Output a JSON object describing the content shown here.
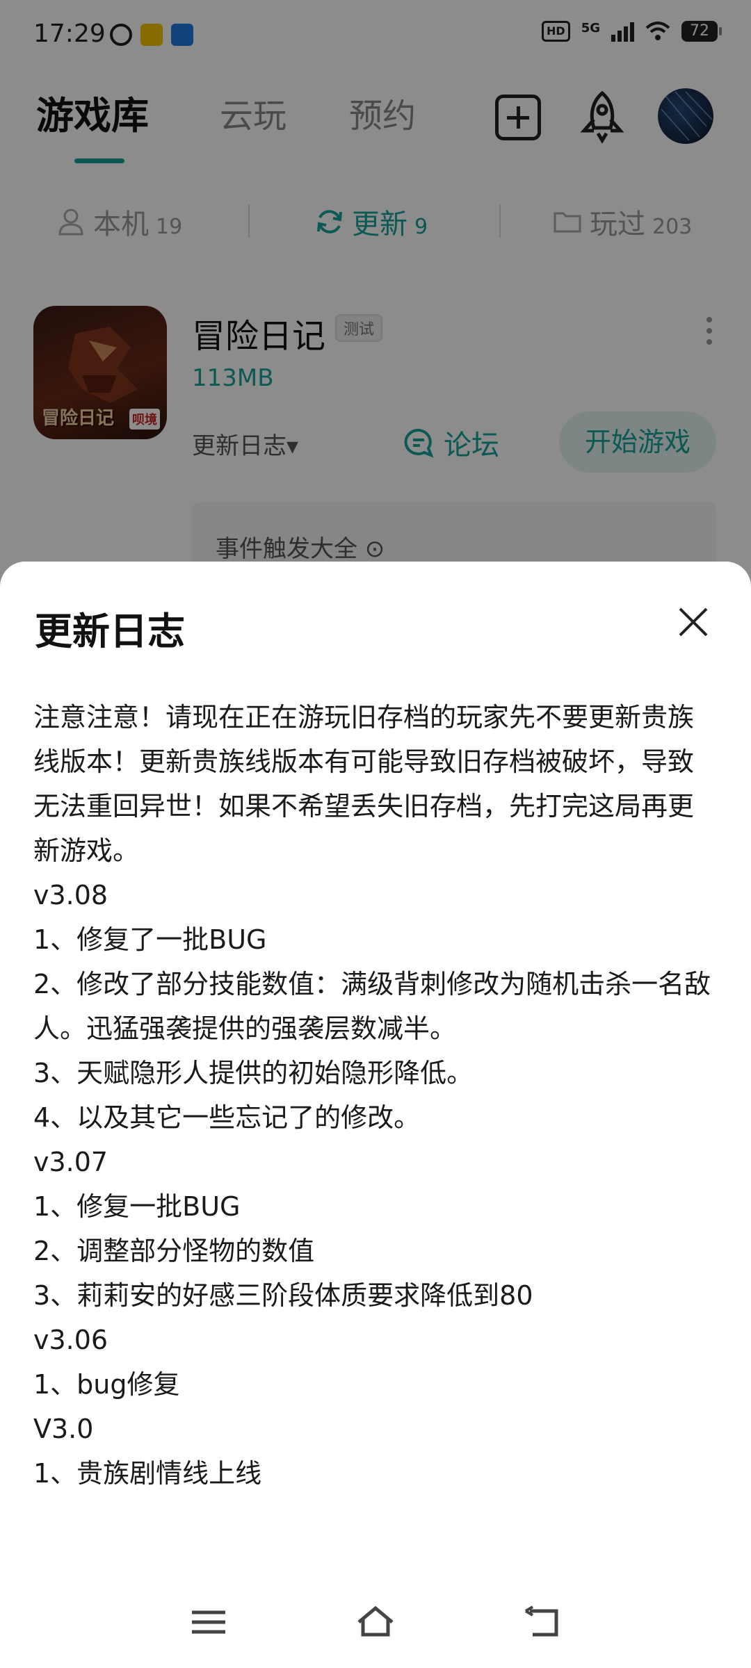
{
  "status_bar": {
    "time": "17:29",
    "hd": "HD",
    "network": "5G",
    "battery": "72"
  },
  "header": {
    "tabs": [
      {
        "label": "游戏库",
        "active": true
      },
      {
        "label": "云玩",
        "active": false
      },
      {
        "label": "预约",
        "active": false
      }
    ],
    "icons": [
      "add-icon",
      "rocket-icon",
      "avatar"
    ]
  },
  "sub_tabs": [
    {
      "label": "本机",
      "count": "19",
      "icon": "user-icon",
      "active": false
    },
    {
      "label": "更新",
      "count": "9",
      "icon": "refresh-icon",
      "active": true
    },
    {
      "label": "玩过",
      "count": "203",
      "icon": "folder-icon",
      "active": false
    }
  ],
  "game": {
    "icon_caption": "冒险日记",
    "icon_brand": "呗境",
    "title": "冒险日记",
    "badge": "测试",
    "size": "113MB",
    "changelog_link": "更新日志▾",
    "forum_label": "论坛",
    "start_label": "开始游戏",
    "event_card": "事件触发大全 ⊙"
  },
  "sheet": {
    "title": "更新日志",
    "lines": [
      "注意注意！请现在正在游玩旧存档的玩家先不要更新贵族线版本！更新贵族线版本有可能导致旧存档被破坏，导致无法重回异世！如果不希望丢失旧存档，先打完这局再更新游戏。",
      "v3.08",
      "1、修复了一批BUG",
      "2、修改了部分技能数值：满级背刺修改为随机击杀一名敌人。迅猛强袭提供的强袭层数减半。",
      "3、天赋隐形人提供的初始隐形降低。",
      "4、以及其它一些忘记了的修改。",
      "v3.07",
      "1、修复一批BUG",
      "2、调整部分怪物的数值",
      "3、莉莉安的好感三阶段体质要求降低到80",
      "v3.06",
      "1、bug修复",
      "V3.0",
      "1、贵族剧情线上线"
    ]
  },
  "colors": {
    "accent": "#16a39a",
    "accent_light": "#e6f5f3",
    "scrim": "rgba(0,0,0,0.45)"
  }
}
